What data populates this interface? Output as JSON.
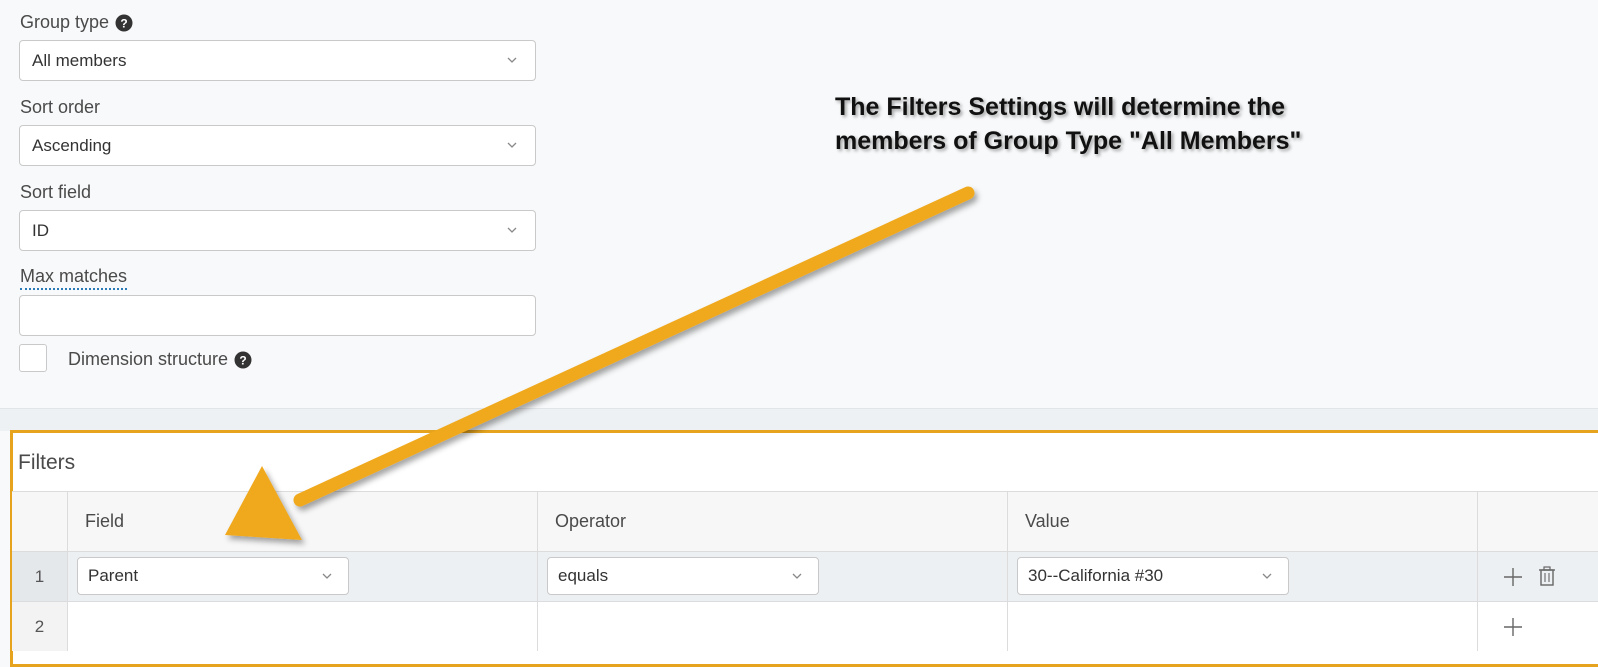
{
  "form": {
    "group_type": {
      "label": "Group type",
      "value": "All members"
    },
    "sort_order": {
      "label": "Sort order",
      "value": "Ascending"
    },
    "sort_field": {
      "label": "Sort field",
      "value": "ID"
    },
    "max_matches": {
      "label": "Max matches",
      "value": ""
    },
    "dimension_structure": {
      "label": "Dimension structure",
      "checked": false
    }
  },
  "filters": {
    "title": "Filters",
    "columns": [
      "Field",
      "Operator",
      "Value"
    ],
    "rows": [
      {
        "num": "1",
        "field": "Parent",
        "operator": "equals",
        "value": "30--California #30",
        "actions": [
          "plus-icon",
          "trash-icon"
        ]
      },
      {
        "num": "2",
        "field": "",
        "operator": "",
        "value": "",
        "actions": [
          "plus-icon"
        ]
      }
    ]
  },
  "annotation": {
    "line1": "The Filters Settings will determine the",
    "line2": "members of Group Type \"All Members\"",
    "arrow_color": "#f0a81c"
  },
  "colors": {
    "highlight_border": "#e6a41e",
    "link_underline": "#2a7ab8"
  }
}
